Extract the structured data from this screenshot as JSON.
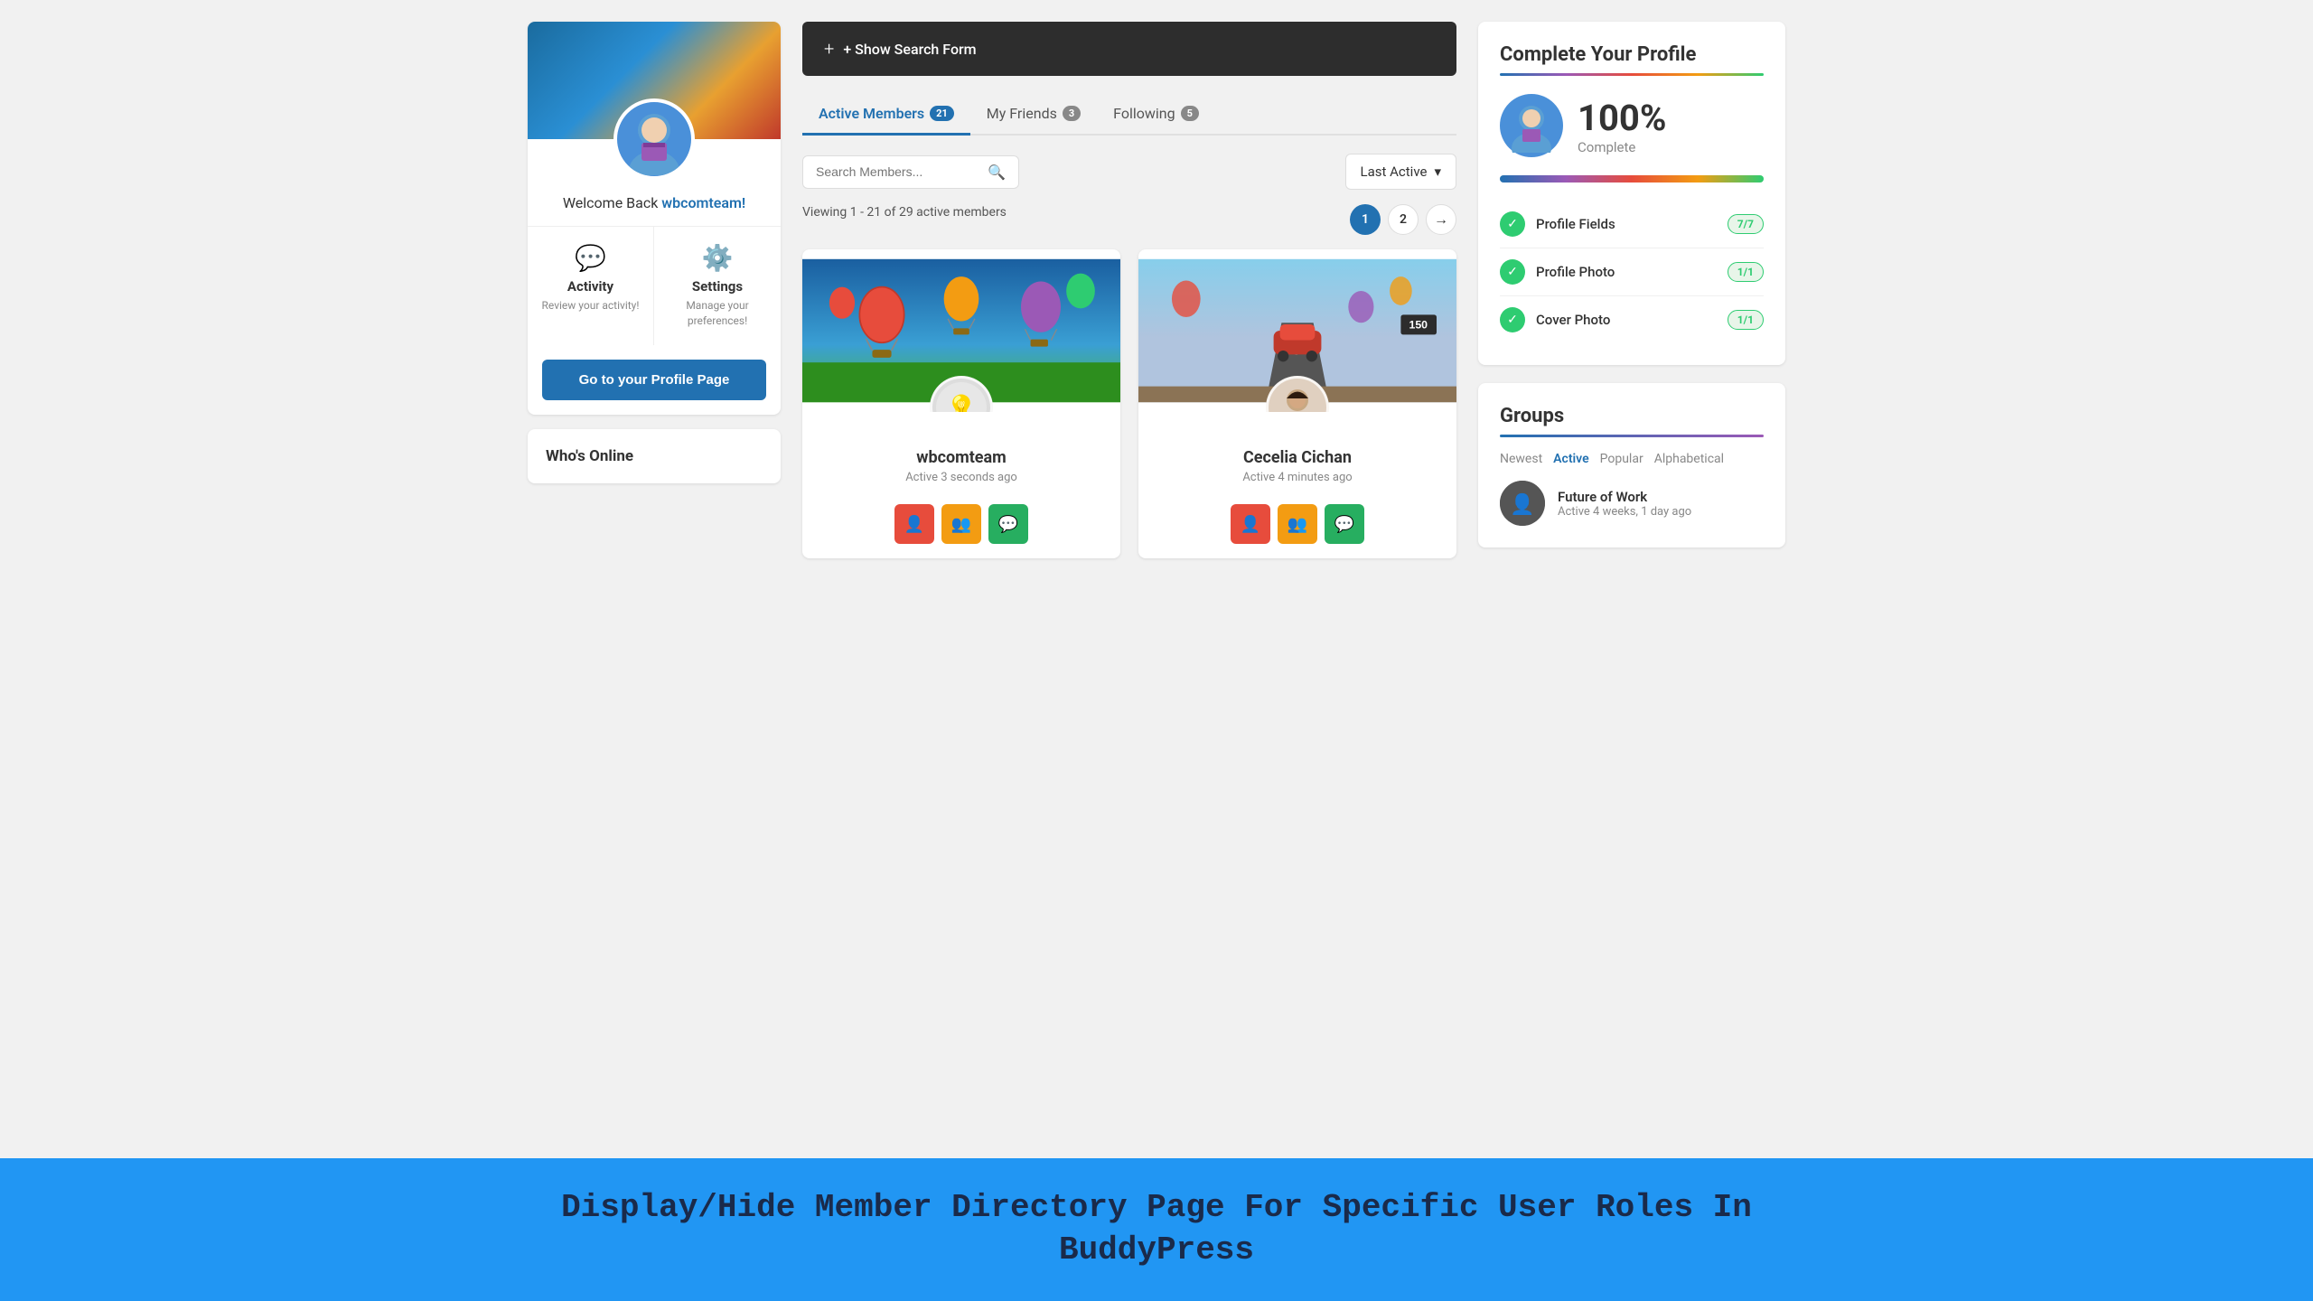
{
  "leftSidebar": {
    "welcome": "Welcome Back",
    "username": "wbcomteam!",
    "activity": {
      "title": "Activity",
      "desc": "Review your activity!"
    },
    "settings": {
      "title": "Settings",
      "desc": "Manage your preferences!"
    },
    "profileBtn": "Go to your Profile Page",
    "whosOnline": "Who's Online"
  },
  "searchBar": {
    "label": "+ Show Search Form"
  },
  "tabs": [
    {
      "label": "Active Members",
      "badge": "21",
      "active": true
    },
    {
      "label": "My Friends",
      "badge": "3",
      "active": false
    },
    {
      "label": "Following",
      "badge": "5",
      "active": false
    }
  ],
  "membersSearch": {
    "placeholder": "Search Members...",
    "sortLabel": "Last Active"
  },
  "viewingInfo": "Viewing 1 - 21 of 29 active members",
  "pagination": {
    "pages": [
      "1",
      "2"
    ],
    "activePage": "1"
  },
  "members": [
    {
      "name": "wbcomteam",
      "activeText": "Active 3 seconds ago",
      "online": true,
      "cover": "balloons"
    },
    {
      "name": "Cecelia Cichan",
      "activeText": "Active 4 minutes ago",
      "online": true,
      "cover": "road"
    }
  ],
  "memberActionBtns": [
    "👤",
    "👥",
    "💬"
  ],
  "rightSidebar": {
    "completeProfile": {
      "title": "Complete Your Profile",
      "percent": "100%",
      "completeLabel": "Complete",
      "fields": [
        {
          "name": "Profile Fields",
          "badge": "7/7"
        },
        {
          "name": "Profile Photo",
          "badge": "1/1"
        },
        {
          "name": "Cover Photo",
          "badge": "1/1"
        }
      ]
    },
    "groups": {
      "title": "Groups",
      "filters": [
        "Newest",
        "Active",
        "Popular",
        "Alphabetical"
      ],
      "activeFilter": "Active",
      "items": [
        {
          "name": "Future of Work",
          "activeText": "Active 4 weeks, 1 day ago"
        }
      ]
    }
  },
  "banner": {
    "line1": "Display/Hide Member Directory Page For Specific User Roles In",
    "line2": "BuddyPress"
  }
}
